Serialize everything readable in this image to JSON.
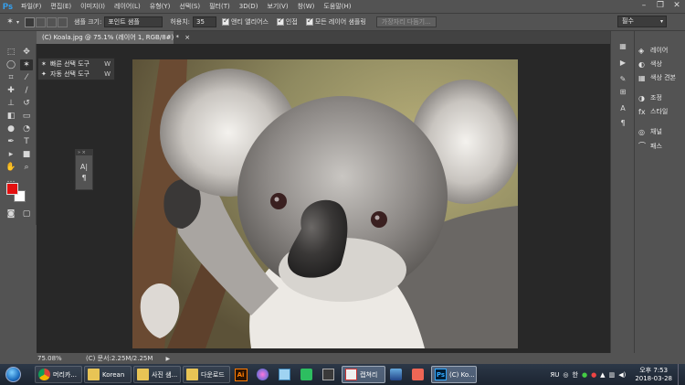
{
  "app": {
    "logo": "Ps"
  },
  "menu": [
    "파일(F)",
    "편집(E)",
    "이미지(I)",
    "레이어(L)",
    "유형(Y)",
    "선택(S)",
    "필터(T)",
    "3D(D)",
    "보기(V)",
    "창(W)",
    "도움말(H)"
  ],
  "window_controls": {
    "minimize": "–",
    "restore": "❐",
    "close": "✕"
  },
  "options": {
    "sample_size_label": "샘플 크기:",
    "sample_size_value": "포인트 샘플",
    "tolerance_label": "허용치:",
    "tolerance_value": "35",
    "antialias_label": "앤티 앨리어스",
    "contiguous_label": "인접",
    "all_layers_label": "모든 레이어 샘플링",
    "refine_edge_label": "가장자리 다듬기...",
    "workspace": "필수"
  },
  "document": {
    "tab_title": "(C) Koala.jpg @ 75.1% (레이어 1, RGB/8#) *",
    "tab_close": "×"
  },
  "flyout": [
    {
      "label": "빠른 선택 도구",
      "key": "W"
    },
    {
      "label": "자동 선택 도구",
      "key": "W"
    }
  ],
  "mini_panel": {
    "glyph_a": "A|",
    "glyph_b": "¶"
  },
  "status": {
    "zoom": "75.08%",
    "doc_info": "(C) 문서:2.25M/2.25M",
    "arrow": "▶"
  },
  "panels": [
    {
      "icon": "layers-icon",
      "label": "레이어"
    },
    {
      "icon": "color-icon",
      "label": "색상"
    },
    {
      "icon": "swatches-icon",
      "label": "색상 견본"
    },
    {
      "icon": "adjustments-icon",
      "label": "조정"
    },
    {
      "icon": "styles-icon",
      "label": "스타일"
    },
    {
      "icon": "channels-icon",
      "label": "채널"
    },
    {
      "icon": "paths-icon",
      "label": "패스"
    }
  ],
  "taskbar": {
    "items": [
      {
        "label": "머리카...",
        "icon": "chrome-icon"
      },
      {
        "label": "Korean",
        "icon": "folder-icon"
      },
      {
        "label": "사진 샘...",
        "icon": "folder-icon"
      },
      {
        "label": "다운로드",
        "icon": "folder-icon"
      },
      {
        "label": "",
        "icon": "illustrator-icon",
        "glyph": "Ai"
      },
      {
        "label": "",
        "icon": "paint-icon"
      },
      {
        "label": "",
        "icon": "notepad-icon"
      },
      {
        "label": "",
        "icon": "evernote-icon"
      },
      {
        "label": "",
        "icon": "kakaotalk-icon"
      },
      {
        "label": "캡쳐리",
        "icon": "capture-icon"
      },
      {
        "label": "",
        "icon": "bandizip-icon"
      },
      {
        "label": "",
        "icon": "media-icon"
      },
      {
        "label": "(C) Ko...",
        "icon": "photoshop-icon",
        "glyph": "Ps"
      }
    ],
    "tray_lang": "한",
    "clock_time": "오후 7:53",
    "clock_date": "2018-03-28"
  }
}
